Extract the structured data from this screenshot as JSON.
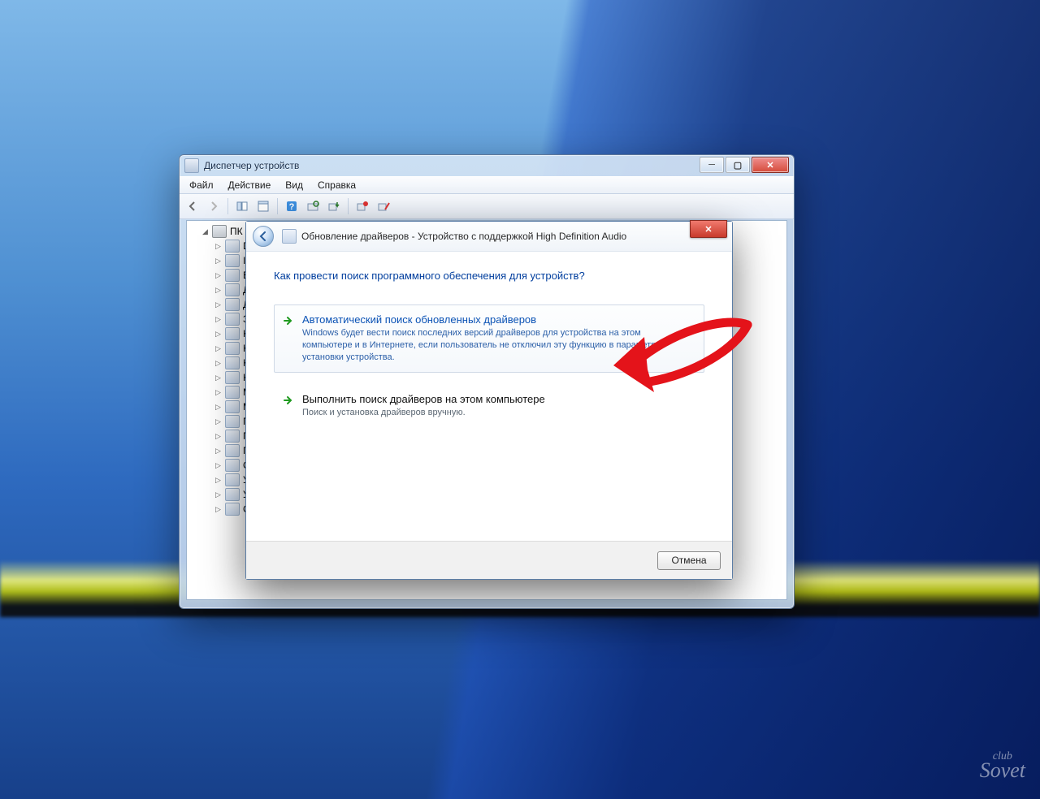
{
  "watermark": {
    "top": "club",
    "bottom": "Sovet"
  },
  "deviceManager": {
    "title": "Диспетчер устройств",
    "menu": [
      "Файл",
      "Действие",
      "Вид",
      "Справка"
    ],
    "rootNode": "ПК",
    "nodes": [
      "D",
      "II",
      "B",
      "Д",
      "Д",
      "З",
      "К",
      "К",
      "К",
      "К",
      "М",
      "М",
      "П",
      "П",
      "П",
      "С",
      "У",
      "У",
      "С"
    ]
  },
  "wizard": {
    "title": "Обновление драйверов - Устройство с поддержкой High Definition Audio",
    "heading": "Как провести поиск программного обеспечения для устройств?",
    "opt1": {
      "title": "Автоматический поиск обновленных драйверов",
      "desc": "Windows будет вести поиск последних версий драйверов для устройства на этом компьютере и в Интернете, если пользователь не отключил эту функцию в параметрах установки устройства."
    },
    "opt2": {
      "title": "Выполнить поиск драйверов на этом компьютере",
      "desc": "Поиск и установка драйверов вручную."
    },
    "cancel": "Отмена"
  }
}
